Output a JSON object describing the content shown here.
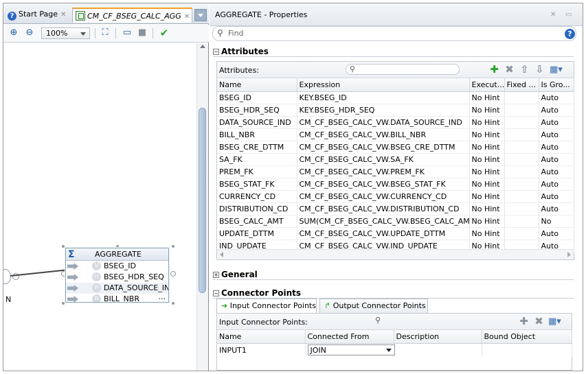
{
  "editor": {
    "tabs": [
      {
        "label": "Start Page",
        "icon": "help-icon"
      },
      {
        "label": "CM_CF_BSEG_CALC_AGG",
        "icon": "mapping-icon"
      }
    ],
    "zoom": "100%",
    "node": {
      "title": "AGGREGATE",
      "attributes": [
        "BSEG_ID",
        "BSEG_HDR_SEQ",
        "DATA_SOURCE_IND",
        "BILL_NBR"
      ],
      "extra": "...",
      "side_label": "N"
    }
  },
  "properties": {
    "title": "AGGREGATE - Properties",
    "find_placeholder": "Find",
    "attributes_section": "Attributes",
    "attributes_label": "Attributes:",
    "columns": [
      "Name",
      "Expression",
      "Execut...",
      "Fixed ...",
      "Is Gro..."
    ],
    "rows": [
      {
        "name": "BSEG_ID",
        "expr": "KEY.BSEG_ID",
        "exec": "No Hint",
        "fixed": "",
        "group": "Auto"
      },
      {
        "name": "BSEG_HDR_SEQ",
        "expr": "KEY.BSEG_HDR_SEQ",
        "exec": "No Hint",
        "fixed": "",
        "group": "Auto"
      },
      {
        "name": "DATA_SOURCE_IND",
        "expr": "CM_CF_BSEG_CALC_VW.DATA_SOURCE_IND",
        "exec": "No Hint",
        "fixed": "",
        "group": "Auto"
      },
      {
        "name": "BILL_NBR",
        "expr": "CM_CF_BSEG_CALC_VW.BILL_NBR",
        "exec": "No Hint",
        "fixed": "",
        "group": "Auto"
      },
      {
        "name": "BSEG_CRE_DTTM",
        "expr": "CM_CF_BSEG_CALC_VW.BSEG_CRE_DTTM",
        "exec": "No Hint",
        "fixed": "",
        "group": "Auto"
      },
      {
        "name": "SA_FK",
        "expr": "CM_CF_BSEG_CALC_VW.SA_FK",
        "exec": "No Hint",
        "fixed": "",
        "group": "Auto"
      },
      {
        "name": "PREM_FK",
        "expr": "CM_CF_BSEG_CALC_VW.PREM_FK",
        "exec": "No Hint",
        "fixed": "",
        "group": "Auto"
      },
      {
        "name": "BSEG_STAT_FK",
        "expr": "CM_CF_BSEG_CALC_VW.BSEG_STAT_FK",
        "exec": "No Hint",
        "fixed": "",
        "group": "Auto"
      },
      {
        "name": "CURRENCY_CD",
        "expr": "CM_CF_BSEG_CALC_VW.CURRENCY_CD",
        "exec": "No Hint",
        "fixed": "",
        "group": "Auto"
      },
      {
        "name": "DISTRIBUTION_CD",
        "expr": "CM_CF_BSEG_CALC_VW.DISTRIBUTION_CD",
        "exec": "No Hint",
        "fixed": "",
        "group": "Auto"
      },
      {
        "name": "BSEG_CALC_AMT",
        "expr": "SUM(CM_CF_BSEG_CALC_VW.BSEG_CALC_AMT)",
        "exec": "No Hint",
        "fixed": "",
        "group": "No"
      },
      {
        "name": "UPDATE_DTTM",
        "expr": "CM_CF_BSEG_CALC_VW.UPDATE_DTTM",
        "exec": "No Hint",
        "fixed": "",
        "group": "Auto"
      },
      {
        "name": "IND_UPDATE",
        "expr": "CM_CF_BSEG_CALC_VW.IND_UPDATE",
        "exec": "No Hint",
        "fixed": "",
        "group": "Auto"
      }
    ],
    "general_section": "General",
    "connector_section": "Connector Points",
    "cp_tabs": [
      "Input Connector Points",
      "Output Connector Points"
    ],
    "cp_label": "Input Connector Points:",
    "cp_columns": [
      "Name",
      "Connected From",
      "Description",
      "Bound Object"
    ],
    "cp_rows": [
      {
        "name": "INPUT1",
        "from": "JOIN",
        "desc": "",
        "bound": ""
      }
    ]
  },
  "colors": {
    "accent": "#2a67c4",
    "add": "#2ea32e",
    "tab_highlight": "#f0a030"
  }
}
